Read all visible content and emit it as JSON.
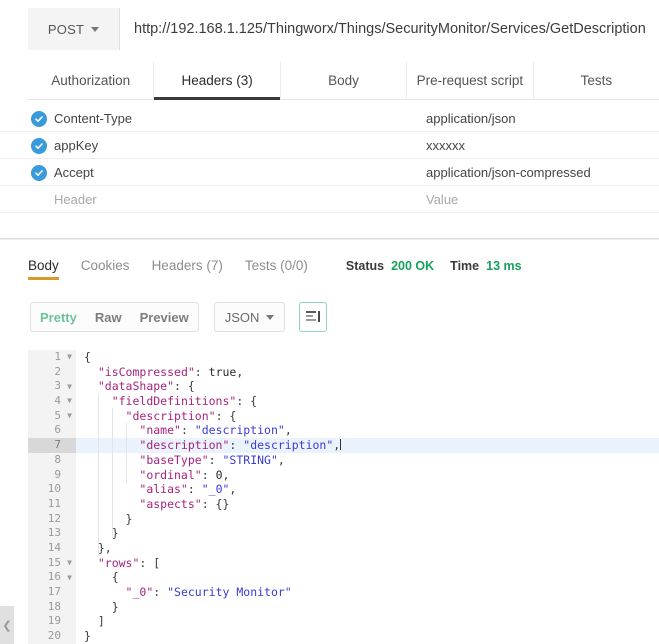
{
  "request": {
    "method": "POST",
    "method_caret_icon": "chevron-down-icon",
    "url": "http://192.168.1.125/Thingworx/Things/SecurityMonitor/Services/GetDescription",
    "tabs": [
      {
        "label": "Authorization",
        "active": false
      },
      {
        "label": "Headers (3)",
        "active": true
      },
      {
        "label": "Body",
        "active": false
      },
      {
        "label": "Pre-request script",
        "active": false
      },
      {
        "label": "Tests",
        "active": false
      }
    ],
    "headers": {
      "rows": [
        {
          "checked": true,
          "key": "Content-Type",
          "value": "application/json"
        },
        {
          "checked": true,
          "key": "appKey",
          "value": "xxxxxx"
        },
        {
          "checked": true,
          "key": "Accept",
          "value": "application/json-compressed"
        }
      ],
      "placeholder_key": "Header",
      "placeholder_value": "Value",
      "check_icon": "checkmark-circle-icon"
    }
  },
  "response": {
    "tabs": [
      {
        "label": "Body",
        "active": true
      },
      {
        "label": "Cookies",
        "active": false
      },
      {
        "label": "Headers (7)",
        "active": false
      },
      {
        "label": "Tests (0/0)",
        "active": false
      }
    ],
    "status_label": "Status",
    "status_value": "200 OK",
    "time_label": "Time",
    "time_value": "13 ms",
    "format_modes": [
      {
        "label": "Pretty",
        "active": true
      },
      {
        "label": "Raw",
        "active": false
      },
      {
        "label": "Preview",
        "active": false
      }
    ],
    "language": "JSON",
    "language_caret_icon": "chevron-down-icon",
    "wrap_icon": "wrap-lines-icon",
    "active_line": 7,
    "code_lines": [
      {
        "num": 1,
        "fold": true,
        "indent": 0,
        "tokens": [
          {
            "t": "p",
            "v": "{"
          }
        ]
      },
      {
        "num": 2,
        "fold": false,
        "indent": 1,
        "tokens": [
          {
            "t": "k",
            "v": "\"isCompressed\""
          },
          {
            "t": "p",
            "v": ": "
          },
          {
            "t": "b",
            "v": "true"
          },
          {
            "t": "p",
            "v": ","
          }
        ]
      },
      {
        "num": 3,
        "fold": true,
        "indent": 1,
        "tokens": [
          {
            "t": "k",
            "v": "\"dataShape\""
          },
          {
            "t": "p",
            "v": ": {"
          }
        ]
      },
      {
        "num": 4,
        "fold": true,
        "indent": 2,
        "tokens": [
          {
            "t": "k",
            "v": "\"fieldDefinitions\""
          },
          {
            "t": "p",
            "v": ": {"
          }
        ]
      },
      {
        "num": 5,
        "fold": true,
        "indent": 3,
        "tokens": [
          {
            "t": "k",
            "v": "\"description\""
          },
          {
            "t": "p",
            "v": ": {"
          }
        ]
      },
      {
        "num": 6,
        "fold": false,
        "indent": 4,
        "tokens": [
          {
            "t": "k",
            "v": "\"name\""
          },
          {
            "t": "p",
            "v": ": "
          },
          {
            "t": "s",
            "v": "\"description\""
          },
          {
            "t": "p",
            "v": ","
          }
        ]
      },
      {
        "num": 7,
        "fold": false,
        "indent": 4,
        "tokens": [
          {
            "t": "k",
            "v": "\"description\""
          },
          {
            "t": "p",
            "v": ": "
          },
          {
            "t": "s",
            "v": "\"description\""
          },
          {
            "t": "p",
            "v": ","
          }
        ],
        "cursor": true
      },
      {
        "num": 8,
        "fold": false,
        "indent": 4,
        "tokens": [
          {
            "t": "k",
            "v": "\"baseType\""
          },
          {
            "t": "p",
            "v": ": "
          },
          {
            "t": "s",
            "v": "\"STRING\""
          },
          {
            "t": "p",
            "v": ","
          }
        ]
      },
      {
        "num": 9,
        "fold": false,
        "indent": 4,
        "tokens": [
          {
            "t": "k",
            "v": "\"ordinal\""
          },
          {
            "t": "p",
            "v": ": "
          },
          {
            "t": "n",
            "v": "0"
          },
          {
            "t": "p",
            "v": ","
          }
        ]
      },
      {
        "num": 10,
        "fold": false,
        "indent": 4,
        "tokens": [
          {
            "t": "k",
            "v": "\"alias\""
          },
          {
            "t": "p",
            "v": ": "
          },
          {
            "t": "s",
            "v": "\"_0\""
          },
          {
            "t": "p",
            "v": ","
          }
        ]
      },
      {
        "num": 11,
        "fold": false,
        "indent": 4,
        "tokens": [
          {
            "t": "k",
            "v": "\"aspects\""
          },
          {
            "t": "p",
            "v": ": {}"
          }
        ]
      },
      {
        "num": 12,
        "fold": false,
        "indent": 3,
        "tokens": [
          {
            "t": "p",
            "v": "}"
          }
        ]
      },
      {
        "num": 13,
        "fold": false,
        "indent": 2,
        "tokens": [
          {
            "t": "p",
            "v": "}"
          }
        ]
      },
      {
        "num": 14,
        "fold": false,
        "indent": 1,
        "tokens": [
          {
            "t": "p",
            "v": "},"
          }
        ]
      },
      {
        "num": 15,
        "fold": true,
        "indent": 1,
        "tokens": [
          {
            "t": "k",
            "v": "\"rows\""
          },
          {
            "t": "p",
            "v": ": ["
          }
        ]
      },
      {
        "num": 16,
        "fold": true,
        "indent": 2,
        "tokens": [
          {
            "t": "p",
            "v": "{"
          }
        ]
      },
      {
        "num": 17,
        "fold": false,
        "indent": 3,
        "tokens": [
          {
            "t": "k",
            "v": "\"_0\""
          },
          {
            "t": "p",
            "v": ": "
          },
          {
            "t": "s",
            "v": "\"Security Monitor\""
          }
        ]
      },
      {
        "num": 18,
        "fold": false,
        "indent": 2,
        "tokens": [
          {
            "t": "p",
            "v": "}"
          }
        ]
      },
      {
        "num": 19,
        "fold": false,
        "indent": 1,
        "tokens": [
          {
            "t": "p",
            "v": "]"
          }
        ]
      },
      {
        "num": 20,
        "fold": false,
        "indent": 0,
        "tokens": [
          {
            "t": "p",
            "v": "}"
          }
        ]
      }
    ]
  },
  "collapse_handle_icon": "chevron-left-icon"
}
